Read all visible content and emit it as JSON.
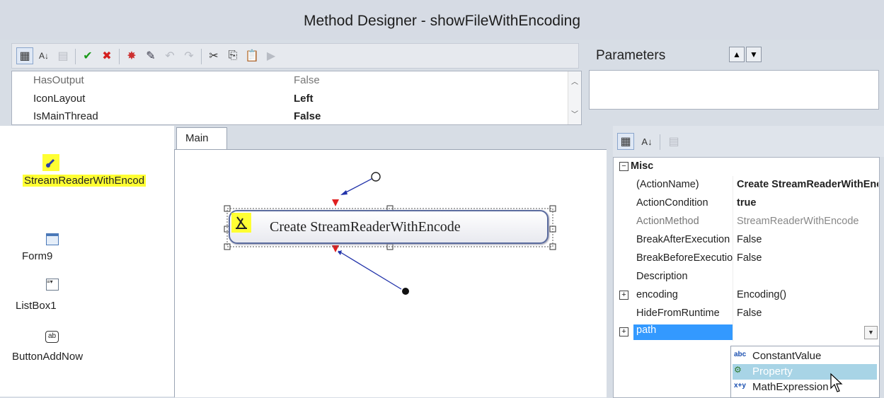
{
  "window": {
    "title": "Method Designer - showFileWithEncoding"
  },
  "toolbar": {
    "buttons": [
      {
        "icon": "categorized-icon",
        "glyph": "▦"
      },
      {
        "icon": "sort-alpha-icon",
        "glyph": "A↓"
      },
      {
        "icon": "property-pages-icon",
        "glyph": "▤"
      },
      {
        "icon": "check-icon",
        "glyph": "✔"
      },
      {
        "icon": "cross-icon",
        "glyph": "✖"
      },
      {
        "icon": "highlight-icon",
        "glyph": "✸"
      },
      {
        "icon": "wand-icon",
        "glyph": "✎"
      },
      {
        "icon": "undo-icon",
        "glyph": "↶"
      },
      {
        "icon": "redo-icon",
        "glyph": "↷"
      },
      {
        "icon": "cut-icon",
        "glyph": "✂"
      },
      {
        "icon": "copy-icon",
        "glyph": "⎘"
      },
      {
        "icon": "paste-icon",
        "glyph": "📋"
      },
      {
        "icon": "run-icon",
        "glyph": "▶"
      }
    ]
  },
  "parameters": {
    "label": "Parameters",
    "up_glyph": "▲",
    "down_glyph": "▼"
  },
  "method_props": [
    {
      "name": "HasOutput",
      "value": "False"
    },
    {
      "name": "IconLayout",
      "value": "Left"
    },
    {
      "name": "IsMainThread",
      "value": "False"
    }
  ],
  "toolbox": {
    "items": [
      {
        "label": "StreamReaderWithEncod",
        "icon": "pointer-icon"
      },
      {
        "label": "Form9",
        "icon": "form-icon"
      },
      {
        "label": "ListBox1",
        "icon": "listbox-icon"
      },
      {
        "label": "ButtonAddNow",
        "icon": "button-icon",
        "glyph": "ab"
      }
    ]
  },
  "designer": {
    "tab": "Main",
    "action_label": "Create StreamReaderWithEncode"
  },
  "property_grid": {
    "category": "Misc",
    "rows": [
      {
        "name": "(ActionName)",
        "value": "Create StreamReaderWithEncode",
        "bold": true
      },
      {
        "name": "ActionCondition",
        "value": "true",
        "bold": true
      },
      {
        "name": "ActionMethod",
        "value": "StreamReaderWithEncode",
        "dim": true
      },
      {
        "name": "BreakAfterExecution",
        "value": "False"
      },
      {
        "name": "BreakBeforeExecution",
        "value": "False"
      },
      {
        "name": "Description",
        "value": ""
      },
      {
        "name": "encoding",
        "value": "Encoding()",
        "expander": "+"
      },
      {
        "name": "HideFromRuntime",
        "value": "False"
      },
      {
        "name": "path",
        "value": "",
        "expander": "+",
        "selected": true
      }
    ],
    "dropdown": [
      {
        "label": "ConstantValue",
        "icon": "abc"
      },
      {
        "label": "Property",
        "icon": "prop",
        "highlighted": true
      },
      {
        "label": "MathExpression",
        "icon": "x+y"
      }
    ]
  },
  "colors": {
    "selection": "#3399ff",
    "highlight_yellow": "#ffff33",
    "dropdown_hover": "#a8d4e6"
  }
}
